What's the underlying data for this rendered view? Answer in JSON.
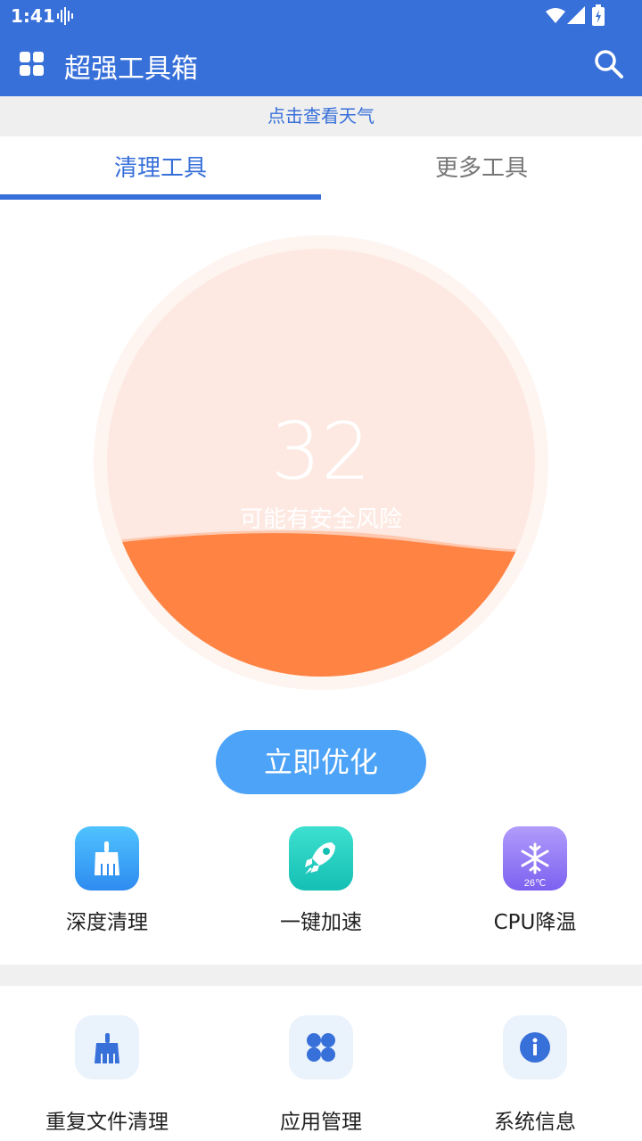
{
  "status_bar": {
    "time": "1:41"
  },
  "app_bar": {
    "title": "超强工具箱"
  },
  "weather_banner": "点击查看天气",
  "tabs": [
    {
      "label": "清理工具",
      "active": true
    },
    {
      "label": "更多工具",
      "active": false
    }
  ],
  "gauge": {
    "score": "32",
    "label": "可能有安全风险",
    "fill_level": 0.32
  },
  "optimize_button": "立即优化",
  "primary_tools": [
    {
      "label": "深度清理",
      "icon": "broom-icon"
    },
    {
      "label": "一键加速",
      "icon": "rocket-icon"
    },
    {
      "label": "CPU降温",
      "icon": "snowflake-icon",
      "badge": "26℃"
    }
  ],
  "secondary_tools": [
    {
      "label": "重复文件清理",
      "icon": "broom-icon"
    },
    {
      "label": "应用管理",
      "icon": "apps-icon"
    },
    {
      "label": "系统信息",
      "icon": "info-icon"
    }
  ],
  "colors": {
    "primary": "#3870D9",
    "gauge_bg": "#FDE9E2",
    "gauge_fill": "#FF8444",
    "button": "#4DA3F7"
  }
}
